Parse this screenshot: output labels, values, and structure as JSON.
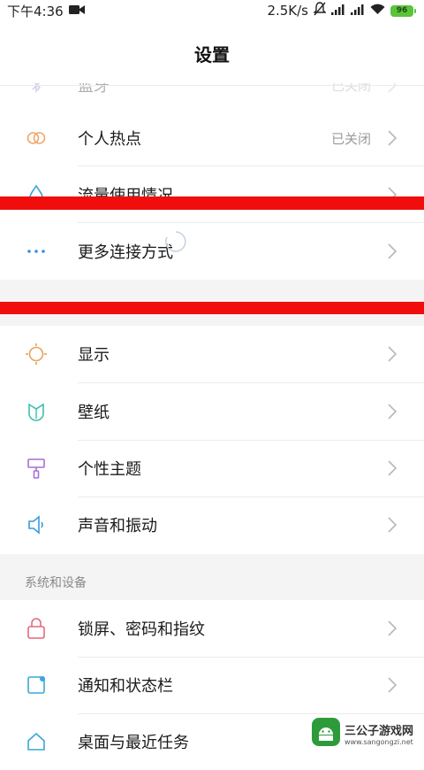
{
  "status_bar": {
    "time": "下午4:36",
    "network_speed": "2.5K/s",
    "battery": "96"
  },
  "header": {
    "title": "设置"
  },
  "network_section": {
    "bluetooth": {
      "label": "蓝牙",
      "value": "已关闭"
    },
    "hotspot": {
      "label": "个人热点",
      "value": "已关闭"
    },
    "data_usage": {
      "label": "流量使用情况"
    },
    "more_connections": {
      "label": "更多连接方式"
    }
  },
  "display_section": {
    "display": {
      "label": "显示"
    },
    "wallpaper": {
      "label": "壁纸"
    },
    "themes": {
      "label": "个性主题"
    },
    "sound": {
      "label": "声音和振动"
    }
  },
  "system_section": {
    "title": "系统和设备",
    "lock_screen": {
      "label": "锁屏、密码和指纹"
    },
    "notifications": {
      "label": "通知和状态栏"
    },
    "home_screen": {
      "label": "桌面与最近任务"
    }
  },
  "watermark": {
    "title": "三公子游戏网",
    "url": "www.sangongzi.net"
  },
  "colors": {
    "hotspot_icon": "#f2a66b",
    "data_icon": "#3aa7d9",
    "more_icon": "#3a8fd9",
    "display_icon": "#e8a457",
    "wallpaper_icon": "#3bbfb0",
    "theme_icon": "#a56fd6",
    "sound_icon": "#3a9be0",
    "lock_icon": "#e26a7c",
    "notif_icon": "#3aa7d9",
    "home_icon": "#3aa7d9",
    "red_band": "#f20d0d"
  }
}
